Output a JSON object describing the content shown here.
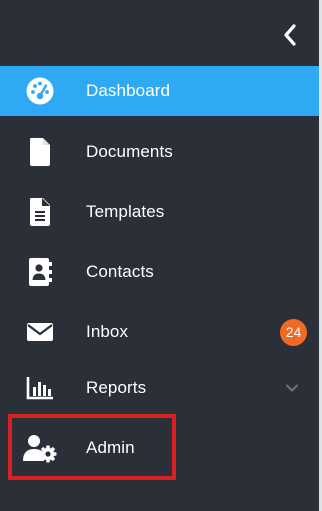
{
  "sidebar": {
    "collapse_icon": "chevron-left-icon",
    "items": [
      {
        "label": "Dashboard",
        "icon": "speedometer-icon",
        "active": true
      },
      {
        "label": "Documents",
        "icon": "document-icon"
      },
      {
        "label": "Templates",
        "icon": "file-text-icon"
      },
      {
        "label": "Contacts",
        "icon": "address-book-icon"
      },
      {
        "label": "Inbox",
        "icon": "envelope-icon",
        "badge": "24"
      },
      {
        "label": "Reports",
        "icon": "bar-chart-icon",
        "expandable": true
      },
      {
        "label": "Admin",
        "icon": "user-gear-icon",
        "highlighted": true
      }
    ]
  },
  "colors": {
    "background": "#2b2f38",
    "active": "#2fa9f4",
    "badge": "#f06a25",
    "highlight": "#d92026"
  }
}
